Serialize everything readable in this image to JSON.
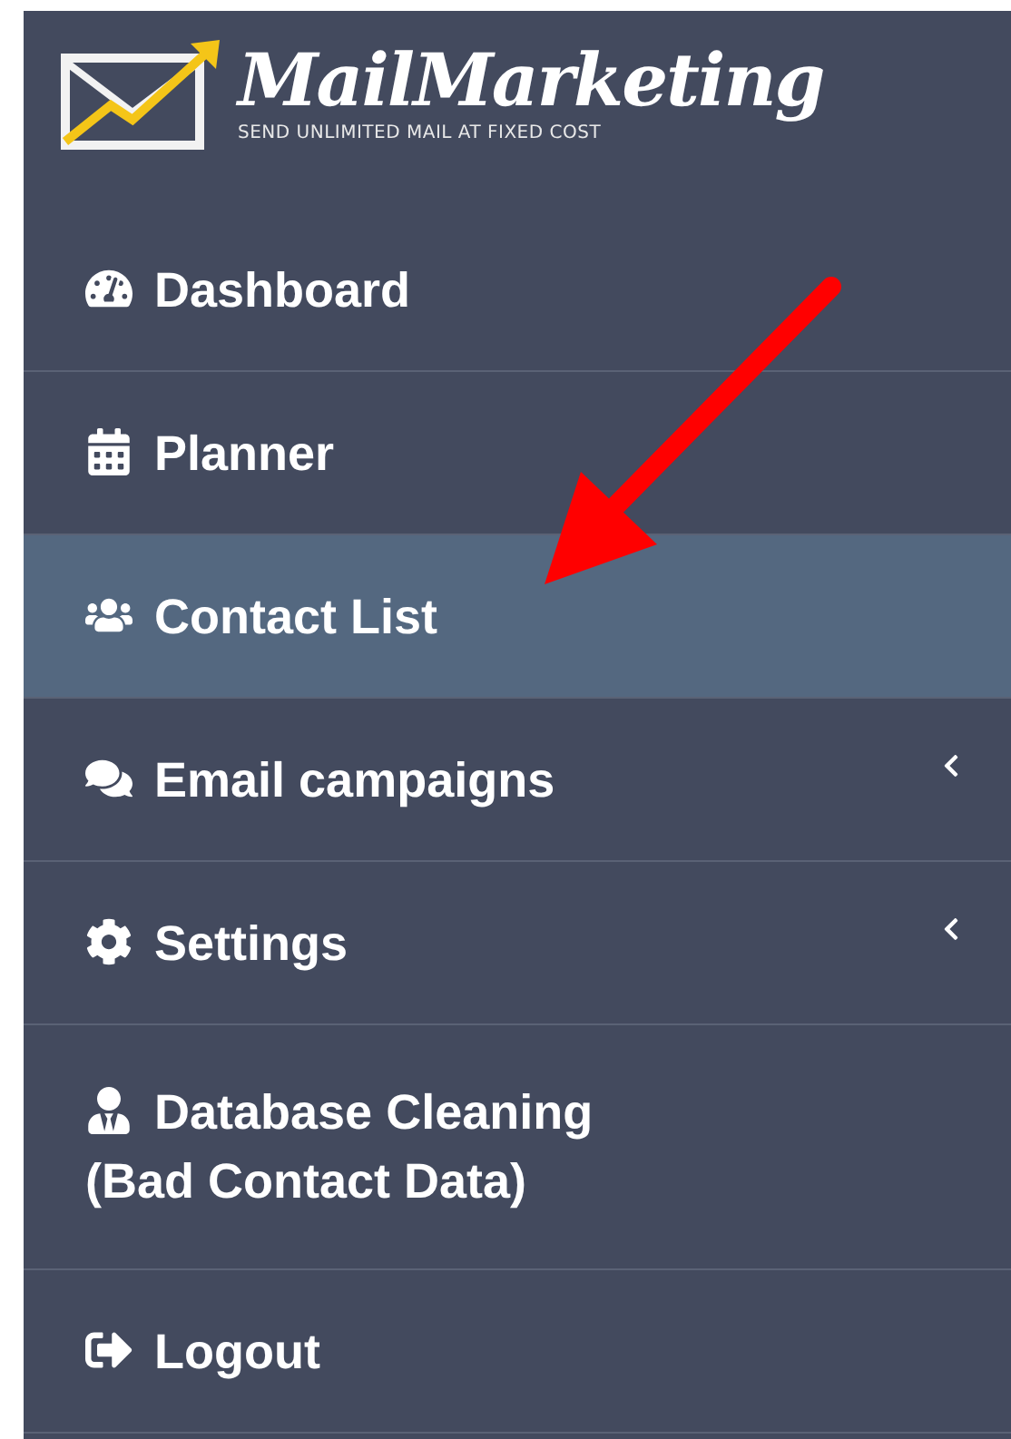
{
  "logo": {
    "title": "MailMarketing",
    "tagline": "SEND UNLIMITED MAIL AT FIXED COST"
  },
  "sidebar": {
    "items": [
      {
        "label": "Dashboard",
        "selected": false,
        "has_submenu": false
      },
      {
        "label": "Planner",
        "selected": false,
        "has_submenu": false
      },
      {
        "label": "Contact List",
        "selected": true,
        "has_submenu": false
      },
      {
        "label": "Email campaigns",
        "selected": false,
        "has_submenu": true
      },
      {
        "label": "Settings",
        "selected": false,
        "has_submenu": true
      },
      {
        "label": "Database Cleaning (Bad Contact Data)",
        "selected": false,
        "has_submenu": false
      },
      {
        "label": "Logout",
        "selected": false,
        "has_submenu": false
      }
    ]
  }
}
